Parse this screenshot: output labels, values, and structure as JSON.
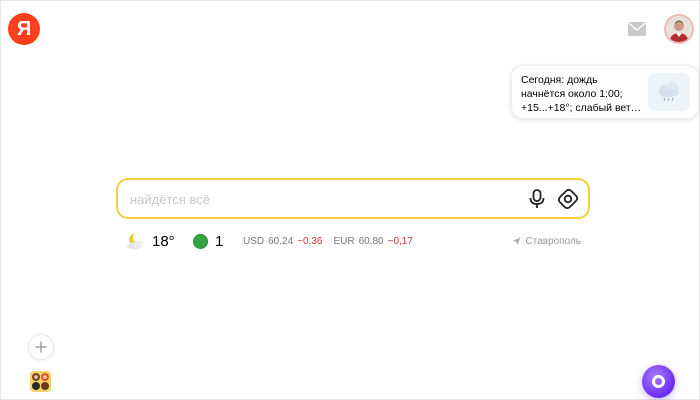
{
  "header": {
    "logo_letter": "Я"
  },
  "weather_widget": {
    "line1": "Сегодня: дождь",
    "line2": "начнётся около 1:00;",
    "line3": "+15...+18°; слабый вете…"
  },
  "search": {
    "placeholder": "найдётся всё",
    "value": ""
  },
  "info": {
    "temperature": "18°",
    "traffic_score": "1",
    "traffic_color": "#33a642",
    "rates": [
      {
        "code": "USD",
        "value": "60.24",
        "change": "−0,36"
      },
      {
        "code": "EUR",
        "value": "60.80",
        "change": "−0,17"
      }
    ],
    "location": "Ставрополь"
  },
  "colors": {
    "brand": "#fc3f1d",
    "search_border": "#f9cd37",
    "alice": "#6b2cf5",
    "rate_negative": "#c0392b"
  },
  "icons": {
    "logo": "yandex-logo-icon",
    "mail": "mail-icon",
    "avatar": "avatar",
    "mic": "microphone-icon",
    "lens": "camera-search-icon",
    "weather": "moon-cloud-icon",
    "traffic": "traffic-light-icon",
    "location": "location-arrow-icon",
    "add": "plus-icon",
    "apps": "apps-grid-icon",
    "alice": "alice-icon"
  }
}
